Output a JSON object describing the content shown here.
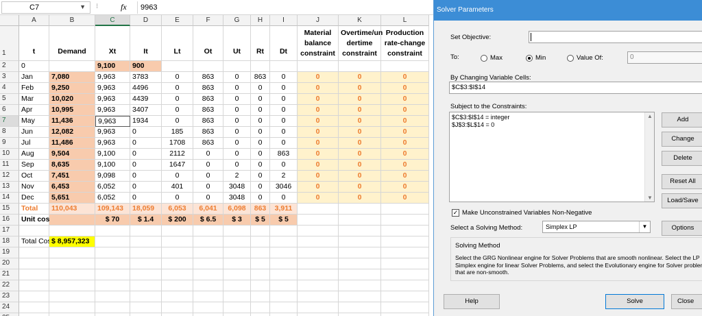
{
  "formula_bar": {
    "name_box": "C7",
    "fx": "fx",
    "formula": "9963"
  },
  "columns": [
    "A",
    "B",
    "C",
    "D",
    "E",
    "F",
    "G",
    "H",
    "I",
    "J",
    "K",
    "L"
  ],
  "rows": [
    "1",
    "2",
    "3",
    "4",
    "5",
    "6",
    "7",
    "8",
    "9",
    "10",
    "11",
    "12",
    "13",
    "14",
    "15",
    "16",
    "17",
    "18",
    "19",
    "20",
    "21",
    "22",
    "23",
    "24",
    "25"
  ],
  "headers": {
    "A": "t",
    "B": "Demand",
    "C": "Xt",
    "D": "It",
    "E": "Lt",
    "F": "Ot",
    "G": "Ut",
    "H": "Rt",
    "I": "Dt",
    "J": "Material balance constraint",
    "K": "Overtime/un dertime constraint",
    "L": "Production rate-change constraint"
  },
  "row2": {
    "A": "0",
    "C": "9,100",
    "D": "900"
  },
  "data_rows": [
    {
      "A": "Jan",
      "B": "7,080",
      "C": "9,963",
      "D": "3783",
      "E": "0",
      "F": "863",
      "G": "0",
      "H": "863",
      "I": "0",
      "J": "0",
      "K": "0",
      "L": "0"
    },
    {
      "A": "Feb",
      "B": "9,250",
      "C": "9,963",
      "D": "4496",
      "E": "0",
      "F": "863",
      "G": "0",
      "H": "0",
      "I": "0",
      "J": "0",
      "K": "0",
      "L": "0"
    },
    {
      "A": "Mar",
      "B": "10,020",
      "C": "9,963",
      "D": "4439",
      "E": "0",
      "F": "863",
      "G": "0",
      "H": "0",
      "I": "0",
      "J": "0",
      "K": "0",
      "L": "0"
    },
    {
      "A": "Apr",
      "B": "10,995",
      "C": "9,963",
      "D": "3407",
      "E": "0",
      "F": "863",
      "G": "0",
      "H": "0",
      "I": "0",
      "J": "0",
      "K": "0",
      "L": "0"
    },
    {
      "A": "May",
      "B": "11,436",
      "C": "9,963",
      "D": "1934",
      "E": "0",
      "F": "863",
      "G": "0",
      "H": "0",
      "I": "0",
      "J": "0",
      "K": "0",
      "L": "0"
    },
    {
      "A": "Jun",
      "B": "12,082",
      "C": "9,963",
      "D": "0",
      "E": "185",
      "F": "863",
      "G": "0",
      "H": "0",
      "I": "0",
      "J": "0",
      "K": "0",
      "L": "0"
    },
    {
      "A": "Jul",
      "B": "11,486",
      "C": "9,963",
      "D": "0",
      "E": "1708",
      "F": "863",
      "G": "0",
      "H": "0",
      "I": "0",
      "J": "0",
      "K": "0",
      "L": "0"
    },
    {
      "A": "Aug",
      "B": "9,504",
      "C": "9,100",
      "D": "0",
      "E": "2112",
      "F": "0",
      "G": "0",
      "H": "0",
      "I": "863",
      "J": "0",
      "K": "0",
      "L": "0"
    },
    {
      "A": "Sep",
      "B": "8,635",
      "C": "9,100",
      "D": "0",
      "E": "1647",
      "F": "0",
      "G": "0",
      "H": "0",
      "I": "0",
      "J": "0",
      "K": "0",
      "L": "0"
    },
    {
      "A": "Oct",
      "B": "7,451",
      "C": "9,098",
      "D": "0",
      "E": "0",
      "F": "0",
      "G": "2",
      "H": "0",
      "I": "2",
      "J": "0",
      "K": "0",
      "L": "0"
    },
    {
      "A": "Nov",
      "B": "6,453",
      "C": "6,052",
      "D": "0",
      "E": "401",
      "F": "0",
      "G": "3048",
      "H": "0",
      "I": "3046",
      "J": "0",
      "K": "0",
      "L": "0"
    },
    {
      "A": "Dec",
      "B": "5,651",
      "C": "6,052",
      "D": "0",
      "E": "0",
      "F": "0",
      "G": "3048",
      "H": "0",
      "I": "0",
      "J": "0",
      "K": "0",
      "L": "0"
    }
  ],
  "totals": {
    "A": "Total",
    "B": "110,043",
    "C": "109,143",
    "D": "18,059",
    "E": "6,053",
    "F": "6,041",
    "G": "6,098",
    "H": "863",
    "I": "3,911"
  },
  "unit_cost": {
    "A": "Unit cost",
    "C": "$ 70",
    "D": "$ 1.4",
    "E": "$ 200",
    "F": "$ 6.5",
    "G": "$ 3",
    "H": "$ 5",
    "I": "$ 5"
  },
  "total_cost": {
    "label": "Total Cost",
    "value": "$ 8,957,323"
  },
  "solver": {
    "title": "Solver Parameters",
    "set_objective_label": "Set Objective:",
    "objective_value": "",
    "to_label": "To:",
    "max_label": "Max",
    "min_label": "Min",
    "value_of_label": "Value Of:",
    "value_of_value": "0",
    "changing_cells_label": "By Changing Variable Cells:",
    "changing_cells_value": "$C$3:$I$14",
    "constraints_label": "Subject to the Constraints:",
    "constraints": [
      "$C$3:$I$14 = integer",
      "$J$3:$L$14 = 0"
    ],
    "add_label": "Add",
    "change_label": "Change",
    "delete_label": "Delete",
    "reset_label": "Reset All",
    "load_save_label": "Load/Save",
    "nonneg_label": "Make Unconstrained Variables Non-Negative",
    "method_label": "Select a Solving Method:",
    "method_value": "Simplex LP",
    "options_label": "Options",
    "solving_method_title": "Solving Method",
    "solving_method_text": "Select the GRG Nonlinear engine for Solver Problems that are smooth nonlinear. Select the LP Simplex engine for linear Solver Problems, and select the Evolutionary engine for Solver problems that are non-smooth.",
    "help_label": "Help",
    "solve_label": "Solve",
    "close_label": "Close"
  }
}
